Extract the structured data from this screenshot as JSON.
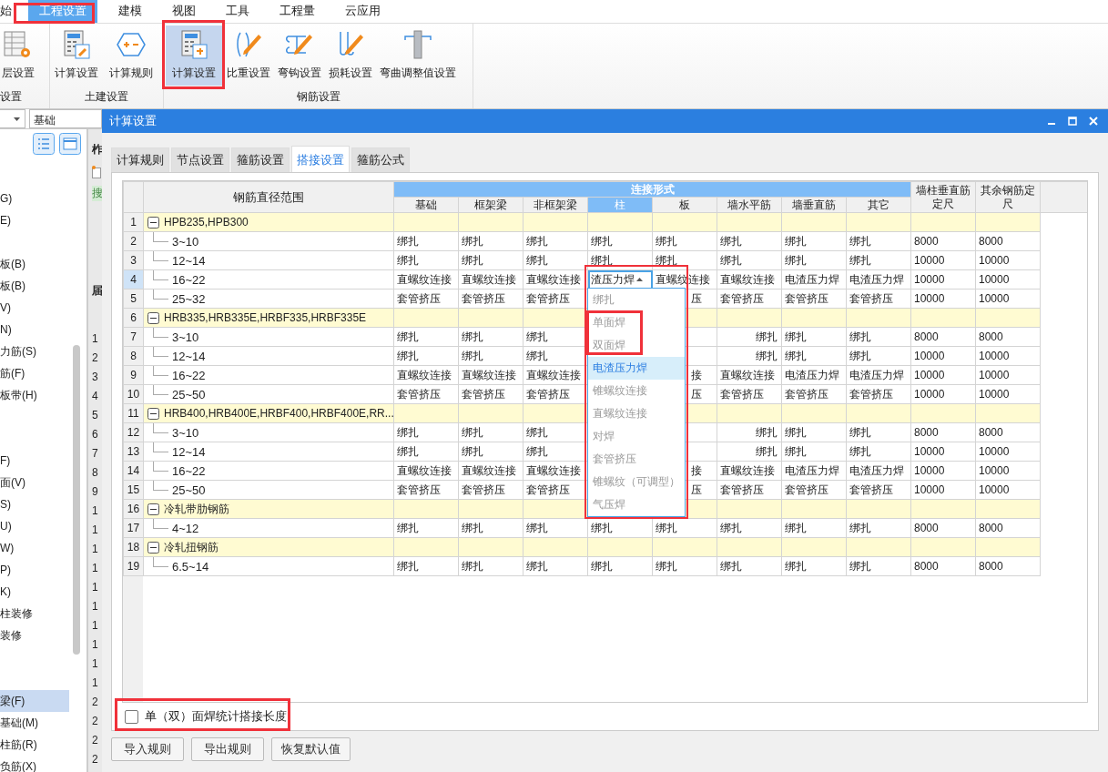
{
  "menu": [
    {
      "label": "始",
      "selected": false
    },
    {
      "label": "工程设置",
      "selected": true
    },
    {
      "label": "建模",
      "selected": false
    },
    {
      "label": "视图",
      "selected": false
    },
    {
      "label": "工具",
      "selected": false
    },
    {
      "label": "工程量",
      "selected": false
    },
    {
      "label": "云应用",
      "selected": false
    }
  ],
  "ribbon": [
    {
      "label": "设置",
      "buttons": [
        {
          "kind": "floors",
          "label": "层设置",
          "selected": false
        }
      ]
    },
    {
      "label": "土建设置",
      "buttons": [
        {
          "kind": "calc",
          "label": "计算设置",
          "selected": false
        },
        {
          "kind": "rule",
          "label": "计算规则",
          "selected": false
        }
      ]
    },
    {
      "label": "钢筋设置",
      "buttons": [
        {
          "kind": "calc2",
          "label": "计算设置",
          "selected": true
        },
        {
          "kind": "weight",
          "label": "比重设置",
          "selected": false
        },
        {
          "kind": "hook",
          "label": "弯钩设置",
          "selected": false
        },
        {
          "kind": "loss",
          "label": "损耗设置",
          "selected": false
        },
        {
          "kind": "bend",
          "label": "弯曲调整值设置",
          "selected": false
        }
      ]
    }
  ],
  "left_panel": {
    "category_field": {
      "value": "基础"
    },
    "items": [
      {
        "kind": "item",
        "label": "G)",
        "selected": false
      },
      {
        "kind": "item",
        "label": "E)",
        "selected": false
      },
      {
        "kind": "spacer",
        "selected": false
      },
      {
        "kind": "item",
        "label": "板(B)",
        "selected": false
      },
      {
        "kind": "item",
        "label": "板(B)",
        "selected": false
      },
      {
        "kind": "item",
        "label": "V)",
        "selected": false
      },
      {
        "kind": "item",
        "label": "N)",
        "selected": false
      },
      {
        "kind": "item",
        "label": "力筋(S)",
        "selected": false
      },
      {
        "kind": "item",
        "label": "筋(F)",
        "selected": false
      },
      {
        "kind": "item",
        "label": "板带(H)",
        "selected": false
      },
      {
        "kind": "spacer",
        "selected": false
      },
      {
        "kind": "spacer",
        "selected": false
      },
      {
        "kind": "item",
        "label": "F)",
        "selected": false
      },
      {
        "kind": "item",
        "label": "面(V)",
        "selected": false
      },
      {
        "kind": "item",
        "label": "S)",
        "selected": false
      },
      {
        "kind": "item",
        "label": "U)",
        "selected": false
      },
      {
        "kind": "item",
        "label": "W)",
        "selected": false
      },
      {
        "kind": "item",
        "label": "P)",
        "selected": false
      },
      {
        "kind": "item",
        "label": "K)",
        "selected": false
      },
      {
        "kind": "item",
        "label": "柱装修",
        "selected": false
      },
      {
        "kind": "item",
        "label": "装修",
        "selected": false
      },
      {
        "kind": "spacer",
        "selected": false
      },
      {
        "kind": "spacer",
        "selected": false
      },
      {
        "kind": "item",
        "label": "梁(F)",
        "selected": true
      },
      {
        "kind": "item",
        "label": "基础(M)",
        "selected": false
      },
      {
        "kind": "item",
        "label": "柱筋(R)",
        "selected": false
      },
      {
        "kind": "item",
        "label": "负筋(X)",
        "selected": false
      }
    ]
  },
  "side_strip": {
    "header": "柞",
    "search_tag": "搜",
    "header_2": "届",
    "row_numbers": [
      "1",
      "2",
      "3",
      "4",
      "5",
      "6",
      "7",
      "8",
      "9",
      "1",
      "1",
      "1",
      "1",
      "1",
      "1",
      "1",
      "1",
      "1",
      "1",
      "2",
      "2",
      "2",
      "2"
    ]
  },
  "dialog": {
    "title": "计算设置",
    "tabs": [
      {
        "label": "计算规则",
        "selected": false
      },
      {
        "label": "节点设置",
        "selected": false
      },
      {
        "label": "箍筋设置",
        "selected": false
      },
      {
        "label": "搭接设置",
        "selected": true
      },
      {
        "label": "箍筋公式",
        "selected": false
      }
    ],
    "table": {
      "header": "钢筋直径范围",
      "group_header": "连接形式",
      "columns": [
        {
          "label": "基础",
          "selected": false
        },
        {
          "label": "框架梁",
          "selected": false
        },
        {
          "label": "非框架梁",
          "selected": false
        },
        {
          "label": "柱",
          "selected": true
        },
        {
          "label": "板",
          "selected": false
        },
        {
          "label": "墙水平筋",
          "selected": false
        },
        {
          "label": "墙垂直筋",
          "selected": false
        },
        {
          "label": "其它",
          "selected": false
        }
      ],
      "size_columns": [
        "墙柱垂直筋定尺",
        "其余钢筋定尺"
      ],
      "rows": [
        {
          "num": "1",
          "kind": "group",
          "label": "HPB235,HPB300",
          "expanded": true
        },
        {
          "num": "2",
          "kind": "child",
          "label": "3~10",
          "cells": [
            "绑扎",
            "绑扎",
            "绑扎",
            "绑扎",
            "绑扎",
            "绑扎",
            "绑扎",
            "绑扎",
            "8000",
            "8000"
          ]
        },
        {
          "num": "3",
          "kind": "child",
          "label": "12~14",
          "cells": [
            "绑扎",
            "绑扎",
            "绑扎",
            "绑扎",
            "绑扎",
            "绑扎",
            "绑扎",
            "绑扎",
            "10000",
            "10000"
          ]
        },
        {
          "num": "4",
          "kind": "child",
          "label": "16~22",
          "cells": [
            "直螺纹连接",
            "直螺纹连接",
            "直螺纹连接",
            {
              "text": "渣压力焊",
              "editing": true
            },
            "直螺纹连接",
            "直螺纹连接",
            "电渣压力焊",
            "电渣压力焊",
            "10000",
            "10000"
          ]
        },
        {
          "num": "5",
          "kind": "child",
          "label": "25~32",
          "cells": [
            "套管挤压",
            "套管挤压",
            "套管挤压",
            null,
            "压",
            "套管挤压",
            "套管挤压",
            "套管挤压",
            "10000",
            "10000"
          ]
        },
        {
          "num": "6",
          "kind": "group",
          "label": "HRB335,HRB335E,HRBF335,HRBF335E",
          "expanded": true
        },
        {
          "num": "7",
          "kind": "child",
          "label": "3~10",
          "cells": [
            "绑扎",
            "绑扎",
            "绑扎",
            null,
            null,
            "绑扎",
            "绑扎",
            "绑扎",
            "8000",
            "8000"
          ]
        },
        {
          "num": "8",
          "kind": "child",
          "label": "12~14",
          "cells": [
            "绑扎",
            "绑扎",
            "绑扎",
            null,
            null,
            "绑扎",
            "绑扎",
            "绑扎",
            "10000",
            "10000"
          ]
        },
        {
          "num": "9",
          "kind": "child",
          "label": "16~22",
          "cells": [
            "直螺纹连接",
            "直螺纹连接",
            "直螺纹连接",
            null,
            "接",
            "直螺纹连接",
            "电渣压力焊",
            "电渣压力焊",
            "10000",
            "10000"
          ]
        },
        {
          "num": "10",
          "kind": "child",
          "label": "25~50",
          "cells": [
            "套管挤压",
            "套管挤压",
            "套管挤压",
            null,
            "压",
            "套管挤压",
            "套管挤压",
            "套管挤压",
            "10000",
            "10000"
          ]
        },
        {
          "num": "11",
          "kind": "group",
          "label": "HRB400,HRB400E,HRBF400,HRBF400E,RR...",
          "expanded": true
        },
        {
          "num": "12",
          "kind": "child",
          "label": "3~10",
          "cells": [
            "绑扎",
            "绑扎",
            "绑扎",
            null,
            null,
            "绑扎",
            "绑扎",
            "绑扎",
            "8000",
            "8000"
          ]
        },
        {
          "num": "13",
          "kind": "child",
          "label": "12~14",
          "cells": [
            "绑扎",
            "绑扎",
            "绑扎",
            null,
            null,
            "绑扎",
            "绑扎",
            "绑扎",
            "10000",
            "10000"
          ]
        },
        {
          "num": "14",
          "kind": "child",
          "label": "16~22",
          "cells": [
            "直螺纹连接",
            "直螺纹连接",
            "直螺纹连接",
            null,
            "接",
            "直螺纹连接",
            "电渣压力焊",
            "电渣压力焊",
            "10000",
            "10000"
          ]
        },
        {
          "num": "15",
          "kind": "child",
          "label": "25~50",
          "cells": [
            "套管挤压",
            "套管挤压",
            "套管挤压",
            null,
            "压",
            "套管挤压",
            "套管挤压",
            "套管挤压",
            "10000",
            "10000"
          ]
        },
        {
          "num": "16",
          "kind": "group",
          "label": "冷轧带肋钢筋",
          "expanded": true
        },
        {
          "num": "17",
          "kind": "child",
          "label": "4~12",
          "cells": [
            "绑扎",
            "绑扎",
            "绑扎",
            "绑扎",
            "绑扎",
            "绑扎",
            "绑扎",
            "绑扎",
            "8000",
            "8000"
          ]
        },
        {
          "num": "18",
          "kind": "group",
          "label": "冷轧扭钢筋",
          "expanded": true
        },
        {
          "num": "19",
          "kind": "child",
          "label": "6.5~14",
          "cells": [
            "绑扎",
            "绑扎",
            "绑扎",
            "绑扎",
            "绑扎",
            "绑扎",
            "绑扎",
            "绑扎",
            "8000",
            "8000"
          ]
        }
      ]
    },
    "dropdown": {
      "options": [
        {
          "label": "绑扎",
          "selected": false
        },
        {
          "label": "单面焊",
          "selected": false
        },
        {
          "label": "双面焊",
          "selected": false
        },
        {
          "label": "电渣压力焊",
          "selected": true
        },
        {
          "label": "锥螺纹连接",
          "selected": false
        },
        {
          "label": "直螺纹连接",
          "selected": false
        },
        {
          "label": "对焊",
          "selected": false
        },
        {
          "label": "套管挤压",
          "selected": false
        },
        {
          "label": "锥螺纹（可调型）",
          "selected": false
        },
        {
          "label": "气压焊",
          "selected": false
        }
      ]
    },
    "checkbox": {
      "label": "单（双）面焊统计搭接长度",
      "checked": false
    },
    "buttons": [
      "导入规则",
      "导出规则",
      "恢复默认值"
    ]
  }
}
